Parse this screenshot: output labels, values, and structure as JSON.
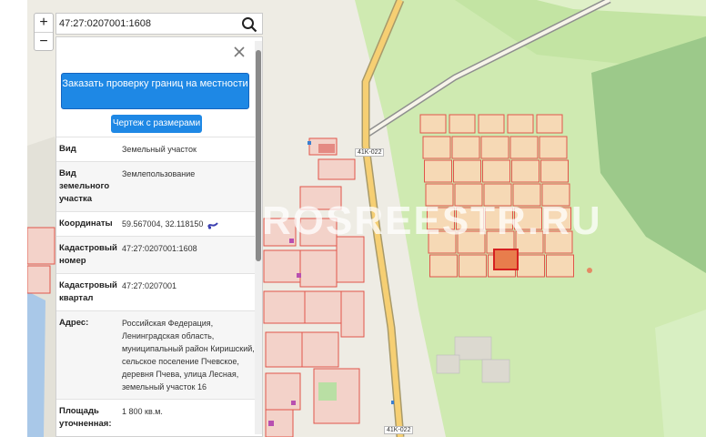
{
  "search": {
    "value": "47:27:0207001:1608",
    "icon": "search-icon"
  },
  "zoom": {
    "in_label": "+",
    "out_label": "−"
  },
  "panel": {
    "close_icon": "close-icon",
    "order_button": "Заказать проверку границ на местности",
    "drawing_button": "Чертеж с размерами",
    "rows": [
      {
        "key": "Вид",
        "value": "Земельный участок"
      },
      {
        "key": "Вид земельного участка",
        "value": "Землепользование"
      },
      {
        "key": "Координаты",
        "value": "59.567004, 32.118150"
      },
      {
        "key": "Кадастровый номер",
        "value": "47:27:0207001:1608"
      },
      {
        "key": "Кадастровый квартал",
        "value": "47:27:0207001"
      },
      {
        "key": "Адрес:",
        "value": "Российская Федерация, Ленинградская область, муниципальный район Киришский, сельское поселение Пчевское, деревня Пчева, улица Лесная, земельный участок 16"
      },
      {
        "key": "Площадь уточненная:",
        "value": "1 800 кв.м."
      }
    ]
  },
  "map": {
    "road_labels": [
      "41K-022",
      "41K-022"
    ],
    "watermark": "ROSREESTR.RU",
    "colors": {
      "parcel": "#e0554a",
      "selected": "#d62020",
      "forest": "#c9e8a8",
      "road": "#f4c96b"
    }
  }
}
